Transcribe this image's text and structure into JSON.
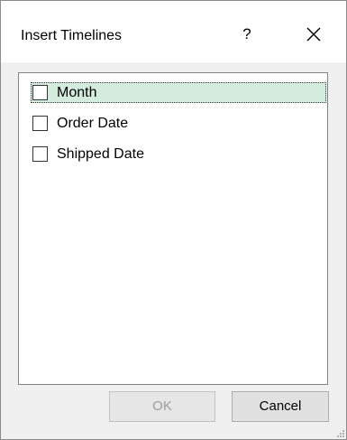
{
  "dialog": {
    "title": "Insert Timelines",
    "help_label": "?",
    "close_icon": "close-icon"
  },
  "fields": [
    {
      "label": "Month",
      "checked": false,
      "selected": true
    },
    {
      "label": "Order Date",
      "checked": false,
      "selected": false
    },
    {
      "label": "Shipped Date",
      "checked": false,
      "selected": false
    }
  ],
  "buttons": {
    "ok_label": "OK",
    "ok_enabled": false,
    "cancel_label": "Cancel"
  },
  "colors": {
    "selection_bg": "#d4ecdd",
    "dialog_bg": "#f0f0f0",
    "disabled_text": "#9d9d9d"
  }
}
